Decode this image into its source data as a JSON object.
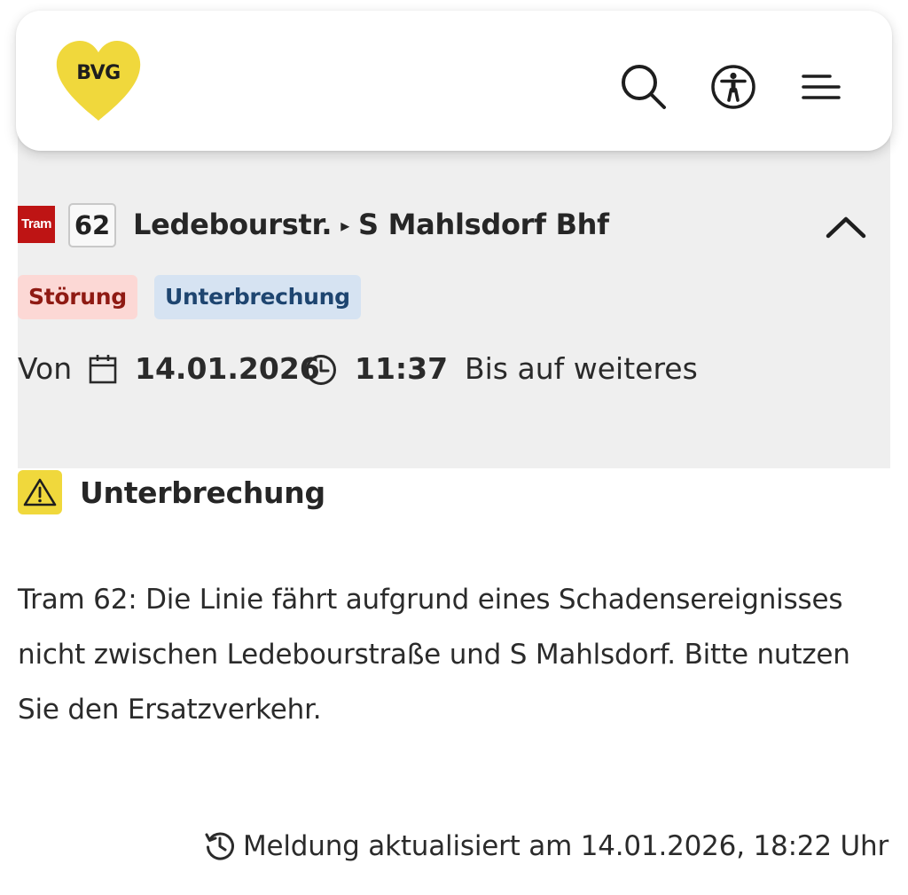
{
  "header": {
    "logo_text": "BVG",
    "logo_color": "#f0d83c",
    "icons": [
      "search-icon",
      "accessibility-icon",
      "menu-icon"
    ]
  },
  "disruption": {
    "mode_label": "Tram",
    "mode_color": "#be1414",
    "line": "62",
    "from": "Ledebourstr.",
    "arrow": "▸",
    "to": "S Mahlsdorf Bhf",
    "tags": {
      "stoerung": "Störung",
      "unterbrechung": "Unterbrechung"
    },
    "period": {
      "from_label": "Von",
      "date": "14.01.2026",
      "time": "11:37",
      "until": "Bis auf weiteres"
    }
  },
  "detail": {
    "title": "Unterbrechung",
    "message": "Tram 62: Die Linie fährt aufgrund eines Schadensereignisses nicht zwischen Ledebourstraße und S Mahlsdorf. Bitte nutzen Sie den Ersatzverkehr.",
    "updated": "Meldung aktualisiert am 14.01.2026, 18:22 Uhr"
  }
}
